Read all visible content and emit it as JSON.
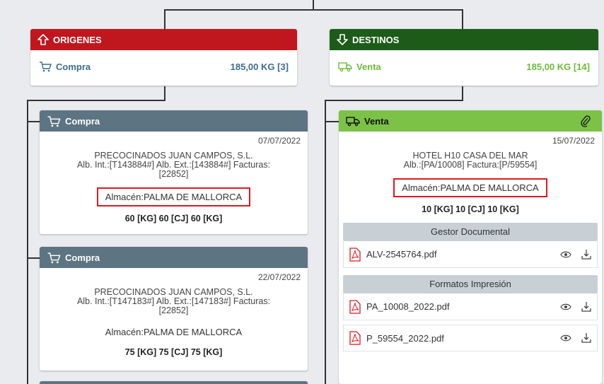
{
  "origenes": {
    "title": "ORIGENES",
    "row_label": "Compra",
    "row_value": "185,00 KG  [3]"
  },
  "destinos": {
    "title": "DESTINOS",
    "row_label": "Venta",
    "row_value": "185,00 KG  [14]"
  },
  "compras": [
    {
      "title": "Compra",
      "date": "07/07/2022",
      "company": "PRECOCINADOS JUAN CAMPOS, S.L.",
      "refs": "Alb. Int.:[T143884#] Alb. Ext.:[143884#] Facturas:",
      "refs2": "[22852]",
      "almacen": "Almacén:PALMA DE MALLORCA",
      "qty": "60 [KG] 60 [CJ] 60 [KG]"
    },
    {
      "title": "Compra",
      "date": "22/07/2022",
      "company": "PRECOCINADOS JUAN CAMPOS, S.L.",
      "refs": "Alb. Int.:[T147183#] Alb. Ext.:[147183#] Facturas:",
      "refs2": "[22852]",
      "almacen": "Almacén:PALMA DE MALLORCA",
      "qty": "75 [KG] 75 [CJ] 75 [KG]"
    }
  ],
  "venta": {
    "title": "Venta",
    "date": "15/07/2022",
    "company": "HOTEL H10 CASA DEL MAR",
    "refs": "Alb.:[PA/10008] Factura:[P/59554]",
    "almacen": "Almacén:PALMA DE MALLORCA",
    "qty": "10 [KG] 10 [CJ] 10 [KG]",
    "gestor_title": "Gestor Documental",
    "gestor_files": [
      "ALV-2545764.pdf"
    ],
    "formatos_title": "Formatos Impresión",
    "formatos_files": [
      "PA_10008_2022.pdf",
      "P_59554_2022.pdf"
    ]
  },
  "colors": {
    "origenes": "#c0171f",
    "destinos": "#1d5b19",
    "compra_header": "#5d7482",
    "venta_header": "#7cc247",
    "highlight": "#e0181f"
  }
}
